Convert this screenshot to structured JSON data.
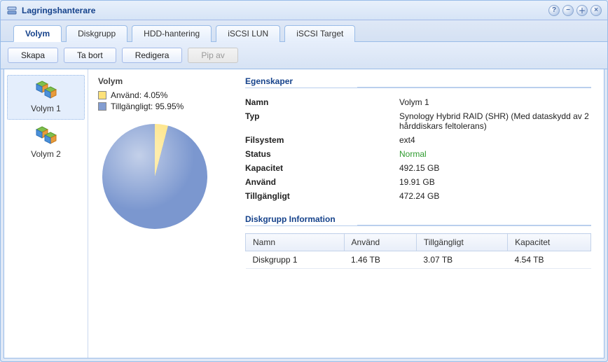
{
  "window": {
    "title": "Lagringshanterare"
  },
  "tabs": [
    {
      "label": "Volym"
    },
    {
      "label": "Diskgrupp"
    },
    {
      "label": "HDD-hantering"
    },
    {
      "label": "iSCSI LUN"
    },
    {
      "label": "iSCSI Target"
    }
  ],
  "toolbar": {
    "create": "Skapa",
    "remove": "Ta bort",
    "edit": "Redigera",
    "beep_off": "Pip av"
  },
  "sidebar": {
    "items": [
      {
        "label": "Volym 1"
      },
      {
        "label": "Volym 2"
      }
    ]
  },
  "volume_panel": {
    "heading": "Volym",
    "legend_used": "Använd: 4.05%",
    "legend_avail": "Tillgängligt: 95.95%"
  },
  "properties": {
    "heading": "Egenskaper",
    "rows": {
      "name_label": "Namn",
      "name_value": "Volym 1",
      "type_label": "Typ",
      "type_value": "Synology Hybrid RAID (SHR) (Med dataskydd av 2 hårddiskars feltolerans)",
      "fs_label": "Filsystem",
      "fs_value": "ext4",
      "status_label": "Status",
      "status_value": "Normal",
      "capacity_label": "Kapacitet",
      "capacity_value": "492.15 GB",
      "used_label": "Använd",
      "used_value": "19.91 GB",
      "avail_label": "Tillgängligt",
      "avail_value": "472.24 GB"
    }
  },
  "diskgroup": {
    "heading": "Diskgrupp Information",
    "columns": {
      "name": "Namn",
      "used": "Använd",
      "avail": "Tillgängligt",
      "capacity": "Kapacitet"
    },
    "rows": [
      {
        "name": "Diskgrupp 1",
        "used": "1.46 TB",
        "avail": "3.07 TB",
        "capacity": "4.54 TB"
      }
    ]
  },
  "chart_data": {
    "type": "pie",
    "title": "Volym",
    "series": [
      {
        "name": "Använd",
        "value": 4.05,
        "color": "#fee27a"
      },
      {
        "name": "Tillgängligt",
        "value": 95.95,
        "color": "#7b97cf"
      }
    ]
  }
}
